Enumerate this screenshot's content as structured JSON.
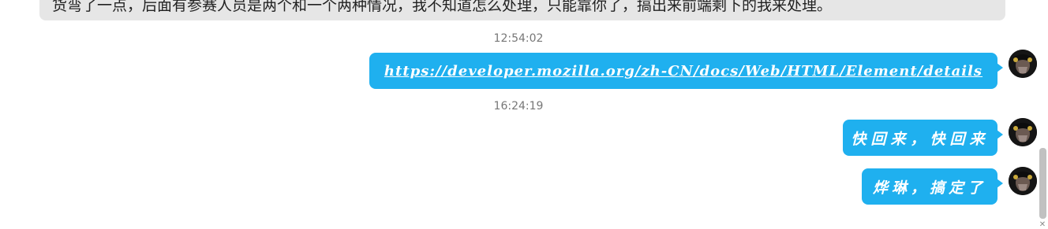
{
  "messages": {
    "received_partial": "货弯了一点，后面有参赛人员是两个和一个两种情况，我不知道怎么处理，只能靠你了，搞出来前端剩下的我来处理。",
    "timestamps": [
      "12:54:02",
      "16:24:19"
    ],
    "sent": [
      "https://developer.mozilla.org/zh-CN/docs/Web/HTML/Element/details",
      "快回来，快回来",
      "烨琳，搞定了"
    ]
  },
  "colors": {
    "sent_bubble": "#1fb0ef",
    "received_bubble": "#e6e6e6",
    "timestamp_text": "#777777"
  },
  "icons": {
    "avatar": "user-avatar-icon",
    "scroll_down": "chevron-down-icon"
  }
}
